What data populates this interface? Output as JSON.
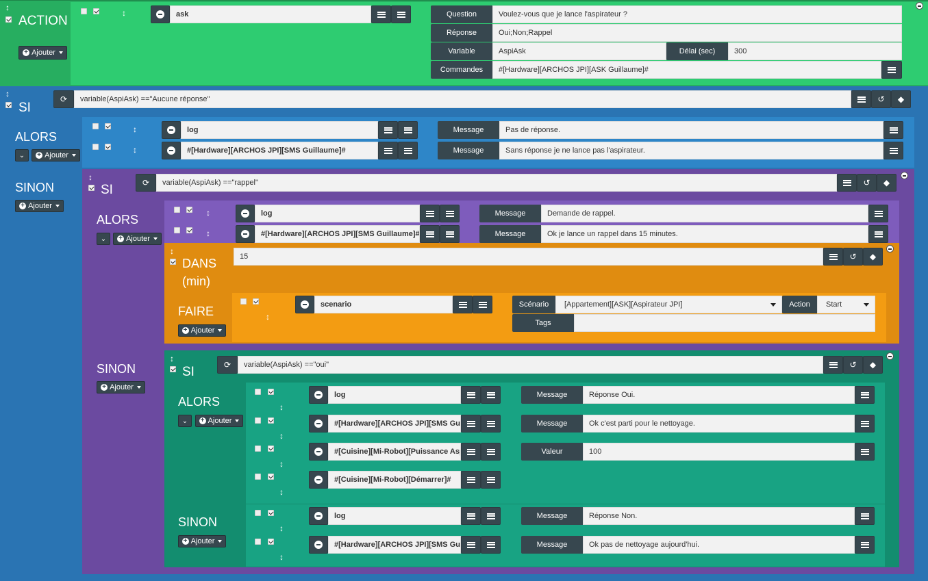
{
  "colors": {
    "action": "#27ae60",
    "si_blue": "#2a74b3",
    "alors_blue": "#2e86c8",
    "si_purple": "#6b4aa0",
    "alors_purple": "#7e5cbc",
    "dans_orange": "#e08c10",
    "faire_orange": "#f39c12",
    "si_teal": "#138d6f",
    "alors_teal": "#18a383",
    "dark": "#37474f"
  },
  "action": {
    "title": "ACTION",
    "add": "Ajouter",
    "cmd": "ask",
    "question_label": "Question",
    "question": "Voulez-vous que je lance l'aspirateur ?",
    "reponse_label": "Réponse",
    "reponse": "Oui;Non;Rappel",
    "variable_label": "Variable",
    "variable": "AspiAsk",
    "delai_label": "Délai (sec)",
    "delai": "300",
    "commandes_label": "Commandes",
    "commandes": "#[Hardware][ARCHOS JPI][ASK Guillaume]#"
  },
  "si1": {
    "title": "SI",
    "condition": "variable(AspiAsk) ==\"Aucune réponse\"",
    "alors": "ALORS",
    "sinon": "SINON",
    "add": "Ajouter",
    "actions": [
      {
        "cmd": "log",
        "label": "Message",
        "value": "Pas de réponse."
      },
      {
        "cmd": "#[Hardware][ARCHOS JPI][SMS Guillaume]#",
        "label": "Message",
        "value": "Sans réponse je ne lance pas l'aspirateur."
      }
    ]
  },
  "si2": {
    "title": "SI",
    "condition": "variable(AspiAsk) ==\"rappel\"",
    "alors": "ALORS",
    "sinon": "SINON",
    "add": "Ajouter",
    "actions": [
      {
        "cmd": "log",
        "label": "Message",
        "value": "Demande de rappel."
      },
      {
        "cmd": "#[Hardware][ARCHOS JPI][SMS Guillaume]#",
        "label": "Message",
        "value": "Ok je lance un rappel dans 15 minutes."
      }
    ]
  },
  "dans": {
    "title1": "DANS",
    "title2": "(min)",
    "value": "15",
    "faire": "FAIRE",
    "add": "Ajouter",
    "cmd": "scenario",
    "scenario_label": "Scénario",
    "scenario": "[Appartement][ASK][Aspirateur JPI]",
    "action_label": "Action",
    "action": "Start",
    "tags_label": "Tags",
    "tags": ""
  },
  "si3": {
    "title": "SI",
    "condition": "variable(AspiAsk) ==\"oui\"",
    "alors": "ALORS",
    "sinon": "SINON",
    "add": "Ajouter",
    "alors_actions": [
      {
        "cmd": "log",
        "label": "Message",
        "value": "Réponse Oui."
      },
      {
        "cmd": "#[Hardware][ARCHOS JPI][SMS Guillaume]#",
        "label": "Message",
        "value": "Ok c'est parti pour le nettoyage."
      },
      {
        "cmd": "#[Cuisine][Mi-Robot][Puissance Aspiration]#",
        "label": "Valeur",
        "value": "100"
      },
      {
        "cmd": "#[Cuisine][Mi-Robot][Démarrer]#"
      }
    ],
    "sinon_actions": [
      {
        "cmd": "log",
        "label": "Message",
        "value": "Réponse Non."
      },
      {
        "cmd": "#[Hardware][ARCHOS JPI][SMS Guillaume]#",
        "label": "Message",
        "value": "Ok pas de nettoyage aujourd'hui."
      }
    ]
  }
}
